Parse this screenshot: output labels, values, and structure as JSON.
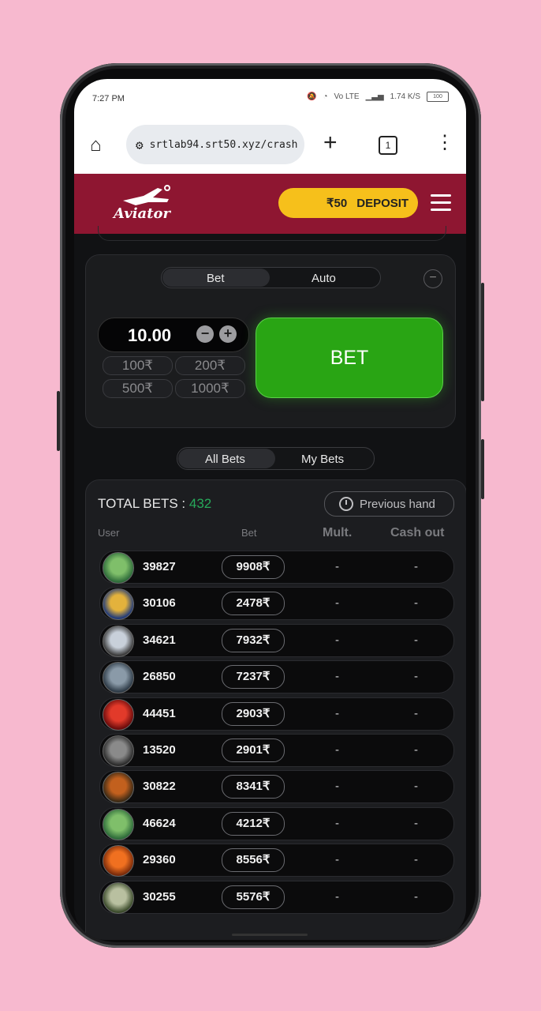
{
  "status_bar": {
    "time": "7:27 PM",
    "network": "Vo LTE",
    "speed": "1.74 K/S",
    "battery": "100"
  },
  "browser": {
    "url": "srtlab94.srt50.xyz/crash",
    "tab_count": "1"
  },
  "header": {
    "logo_text": "Aviator",
    "balance": "₹50",
    "deposit_label": "DEPOSIT"
  },
  "bet_panel": {
    "tabs": [
      "Bet",
      "Auto"
    ],
    "active_tab": "Bet",
    "stake": "10.00",
    "quick_amounts": [
      "100₹",
      "200₹",
      "500₹",
      "1000₹"
    ],
    "bet_button": "BET"
  },
  "bets": {
    "tabs": [
      "All Bets",
      "My Bets"
    ],
    "active_tab": "All Bets",
    "total_label": "TOTAL BETS :",
    "total_count": "432",
    "previous_hand": "Previous hand",
    "columns": [
      "User",
      "Bet",
      "Mult.",
      "Cash out"
    ],
    "rows": [
      {
        "user": "39827",
        "bet": "9908₹",
        "mult": "-",
        "cashout": "-"
      },
      {
        "user": "30106",
        "bet": "2478₹",
        "mult": "-",
        "cashout": "-"
      },
      {
        "user": "34621",
        "bet": "7932₹",
        "mult": "-",
        "cashout": "-"
      },
      {
        "user": "26850",
        "bet": "7237₹",
        "mult": "-",
        "cashout": "-"
      },
      {
        "user": "44451",
        "bet": "2903₹",
        "mult": "-",
        "cashout": "-"
      },
      {
        "user": "13520",
        "bet": "2901₹",
        "mult": "-",
        "cashout": "-"
      },
      {
        "user": "30822",
        "bet": "8341₹",
        "mult": "-",
        "cashout": "-"
      },
      {
        "user": "46624",
        "bet": "4212₹",
        "mult": "-",
        "cashout": "-"
      },
      {
        "user": "29360",
        "bet": "8556₹",
        "mult": "-",
        "cashout": "-"
      },
      {
        "user": "30255",
        "bet": "5576₹",
        "mult": "-",
        "cashout": "-"
      }
    ]
  },
  "colors": {
    "brand": "#8e1631",
    "deposit": "#f6c01b",
    "bet_green": "#29a514",
    "count_green": "#27a95a"
  }
}
